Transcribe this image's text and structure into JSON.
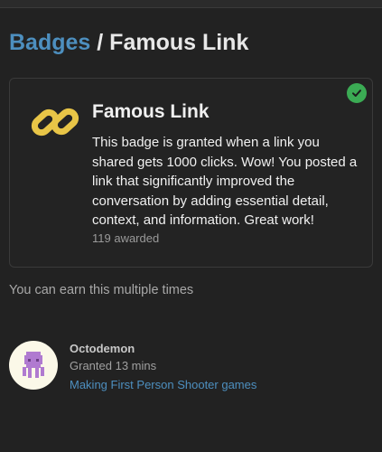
{
  "breadcrumb": {
    "parent_label": "Badges",
    "separator": "/",
    "current_label": "Famous Link"
  },
  "badge": {
    "name": "Famous Link",
    "description": "This badge is granted when a link you shared gets 1000 clicks. Wow! You posted a link that significantly improved the conversation by adding essential detail, context, and information. Great work!",
    "awarded_count": "119 awarded",
    "icon": "chain-link-icon",
    "icon_color": "#e8c547",
    "earned_status_icon": "check-icon",
    "earned_status_color": "#3bab54"
  },
  "earn_note": "You can earn this multiple times",
  "grant": {
    "user_name": "Octodemon",
    "granted_time": "Granted 13 mins",
    "topic_title": "Making First Person Shooter games",
    "avatar_icon": "octopus-avatar-icon"
  },
  "colors": {
    "background": "#222222",
    "link": "#4d8fbf",
    "card_border": "#3a3a3a"
  }
}
